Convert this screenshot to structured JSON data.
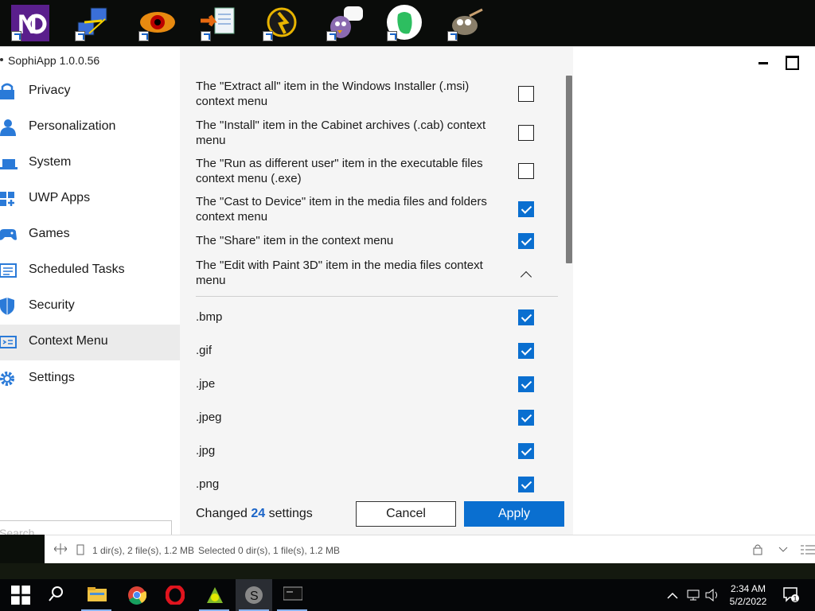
{
  "desktop": {
    "icons": [
      "nd-app-icon",
      "network-tool-icon",
      "eye-app-icon",
      "file-transfer-icon",
      "pikachu-app-icon",
      "pidgin-icon",
      "evernote-icon",
      "gimp-icon"
    ]
  },
  "window": {
    "title": "SophiApp 1.0.0.56"
  },
  "sidebar": {
    "items": [
      {
        "label": "Privacy",
        "icon": "lock-icon"
      },
      {
        "label": "Personalization",
        "icon": "user-icon"
      },
      {
        "label": "System",
        "icon": "laptop-icon"
      },
      {
        "label": "UWP Apps",
        "icon": "apps-icon"
      },
      {
        "label": "Games",
        "icon": "gamepad-icon"
      },
      {
        "label": "Scheduled Tasks",
        "icon": "tasks-icon"
      },
      {
        "label": "Security",
        "icon": "shield-icon"
      },
      {
        "label": "Context Menu",
        "icon": "context-menu-icon",
        "active": true
      },
      {
        "label": "Settings",
        "icon": "gear-icon"
      }
    ],
    "search_placeholder": "Search"
  },
  "settings": [
    {
      "text": "The \"Extract all\" item in the Windows Installer (.msi) context menu",
      "checked": false
    },
    {
      "text": "The \"Install\" item in the Cabinet archives (.cab) context menu",
      "checked": false
    },
    {
      "text": "The \"Run as different user\" item in the executable files context menu (.exe)",
      "checked": false
    },
    {
      "text": "The \"Cast to Device\" item in the media files and folders context menu",
      "checked": true
    },
    {
      "text": "The \"Share\" item in the context menu",
      "checked": true
    },
    {
      "text": "The \"Edit with Paint 3D\" item in the media files context menu",
      "expanded": true
    }
  ],
  "extensions": [
    {
      "text": ".bmp",
      "checked": true
    },
    {
      "text": ".gif",
      "checked": true
    },
    {
      "text": ".jpe",
      "checked": true
    },
    {
      "text": ".jpeg",
      "checked": true
    },
    {
      "text": ".jpg",
      "checked": true
    },
    {
      "text": ".png",
      "checked": true
    }
  ],
  "footer": {
    "changed_prefix": "Changed",
    "changed_count": "24",
    "changed_suffix": "settings",
    "cancel_label": "Cancel",
    "apply_label": "Apply"
  },
  "statusbar": {
    "dir_info": "1 dir(s), 2 file(s), 1.2 MB",
    "selected_info": "Selected 0 dir(s), 1 file(s), 1.2 MB"
  },
  "taskbar": {
    "time": "2:34 AM",
    "date": "5/2/2022",
    "notification_count": "1"
  },
  "colors": {
    "accent": "#0a6fd0",
    "count": "#1a64c8"
  }
}
